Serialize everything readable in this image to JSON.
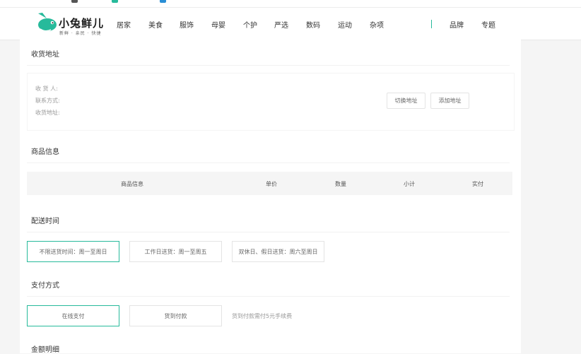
{
  "brand": {
    "name": "小兔鲜儿",
    "slogan": "新鲜 · 亲民 · 快捷",
    "accent_color": "#27ba9b"
  },
  "nav": {
    "items": [
      "居家",
      "美食",
      "服饰",
      "母婴",
      "个护",
      "严选",
      "数码",
      "运动",
      "杂项"
    ],
    "right_items": [
      "品牌",
      "专题"
    ]
  },
  "address": {
    "title": "收货地址",
    "labels": [
      "收 货 人:",
      "联系方式:",
      "收货地址:"
    ],
    "switch_button": "切换地址",
    "add_button": "添加地址"
  },
  "goods": {
    "title": "商品信息",
    "columns": [
      "商品信息",
      "单价",
      "数量",
      "小计",
      "实付"
    ]
  },
  "delivery": {
    "title": "配送时间",
    "options": [
      "不限送货时间：周一至周日",
      "工作日送货：周一至周五",
      "双休日、假日送货：周六至周日"
    ],
    "selected": "不限送货时间：周一至周日"
  },
  "payment": {
    "title": "支付方式",
    "options": [
      "在线支付",
      "货到付款"
    ],
    "selected": "在线支付",
    "tip": "货到付款需付5元手续费"
  },
  "summary": {
    "title": "金额明细"
  }
}
